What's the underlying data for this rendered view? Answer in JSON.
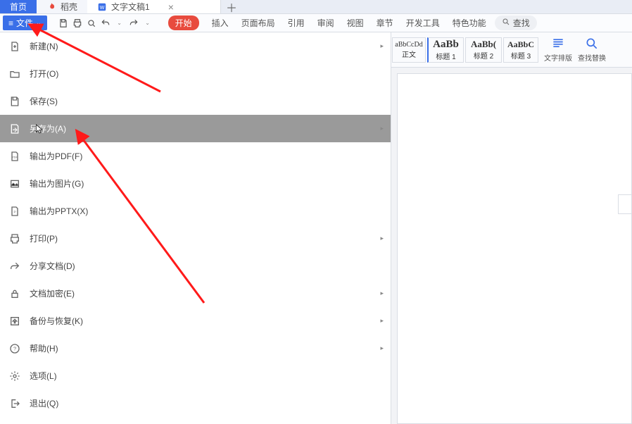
{
  "tabs": {
    "home": "首页",
    "shell": "稻壳",
    "doc": "文字文稿1"
  },
  "file_button": "文件",
  "ribbon": {
    "tabs": [
      "开始",
      "插入",
      "页面布局",
      "引用",
      "审阅",
      "视图",
      "章节",
      "开发工具",
      "特色功能"
    ],
    "search": "查找"
  },
  "styles": {
    "s0": {
      "sample": "aBbCcDd",
      "label": "正文"
    },
    "s1": {
      "sample": "AaBb",
      "label": "标题 1"
    },
    "s2": {
      "sample": "AaBb(",
      "label": "标题 2"
    },
    "s3": {
      "sample": "AaBbC",
      "label": "标题 3"
    }
  },
  "ribbon_groups": {
    "layout": "文字排版",
    "findreplace": "查找替换"
  },
  "menu": {
    "new": "新建(N)",
    "open": "打开(O)",
    "save": "保存(S)",
    "saveas": "另存为(A)",
    "pdf": "输出为PDF(F)",
    "img": "输出为图片(G)",
    "pptx": "输出为PPTX(X)",
    "print": "打印(P)",
    "share": "分享文档(D)",
    "encrypt": "文档加密(E)",
    "backup": "备份与恢复(K)",
    "help": "帮助(H)",
    "options": "选项(L)",
    "exit": "退出(Q)"
  }
}
